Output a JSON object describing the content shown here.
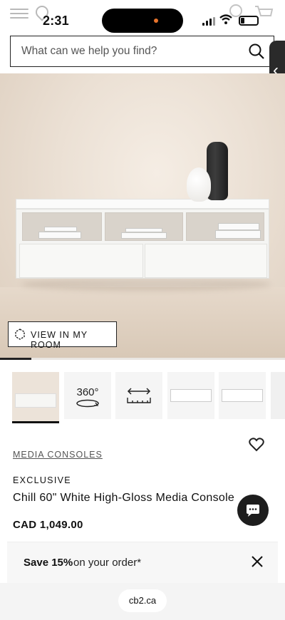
{
  "status": {
    "time": "2:31"
  },
  "search": {
    "placeholder": "What can we help you find?"
  },
  "hero": {
    "view_in_room_label": "VIEW IN MY ROOM",
    "progress": 0.11
  },
  "thumbnails": [
    {
      "kind": "photo"
    },
    {
      "kind": "360",
      "caption": "360°"
    },
    {
      "kind": "dimensions"
    },
    {
      "kind": "photo-front"
    },
    {
      "kind": "photo-angle"
    },
    {
      "kind": "photo-partial"
    }
  ],
  "product": {
    "category": "MEDIA CONSOLES",
    "badge": "EXCLUSIVE",
    "title": "Chill 60\" White High-Gloss Media Console",
    "price": "CAD 1,049.00"
  },
  "promo": {
    "strong": "Save 15%",
    "text": "on your order*"
  },
  "browser": {
    "url": "cb2.ca"
  },
  "colors": {
    "accent": "#1d1d1d",
    "hero_bg": "#ebe0d4"
  }
}
